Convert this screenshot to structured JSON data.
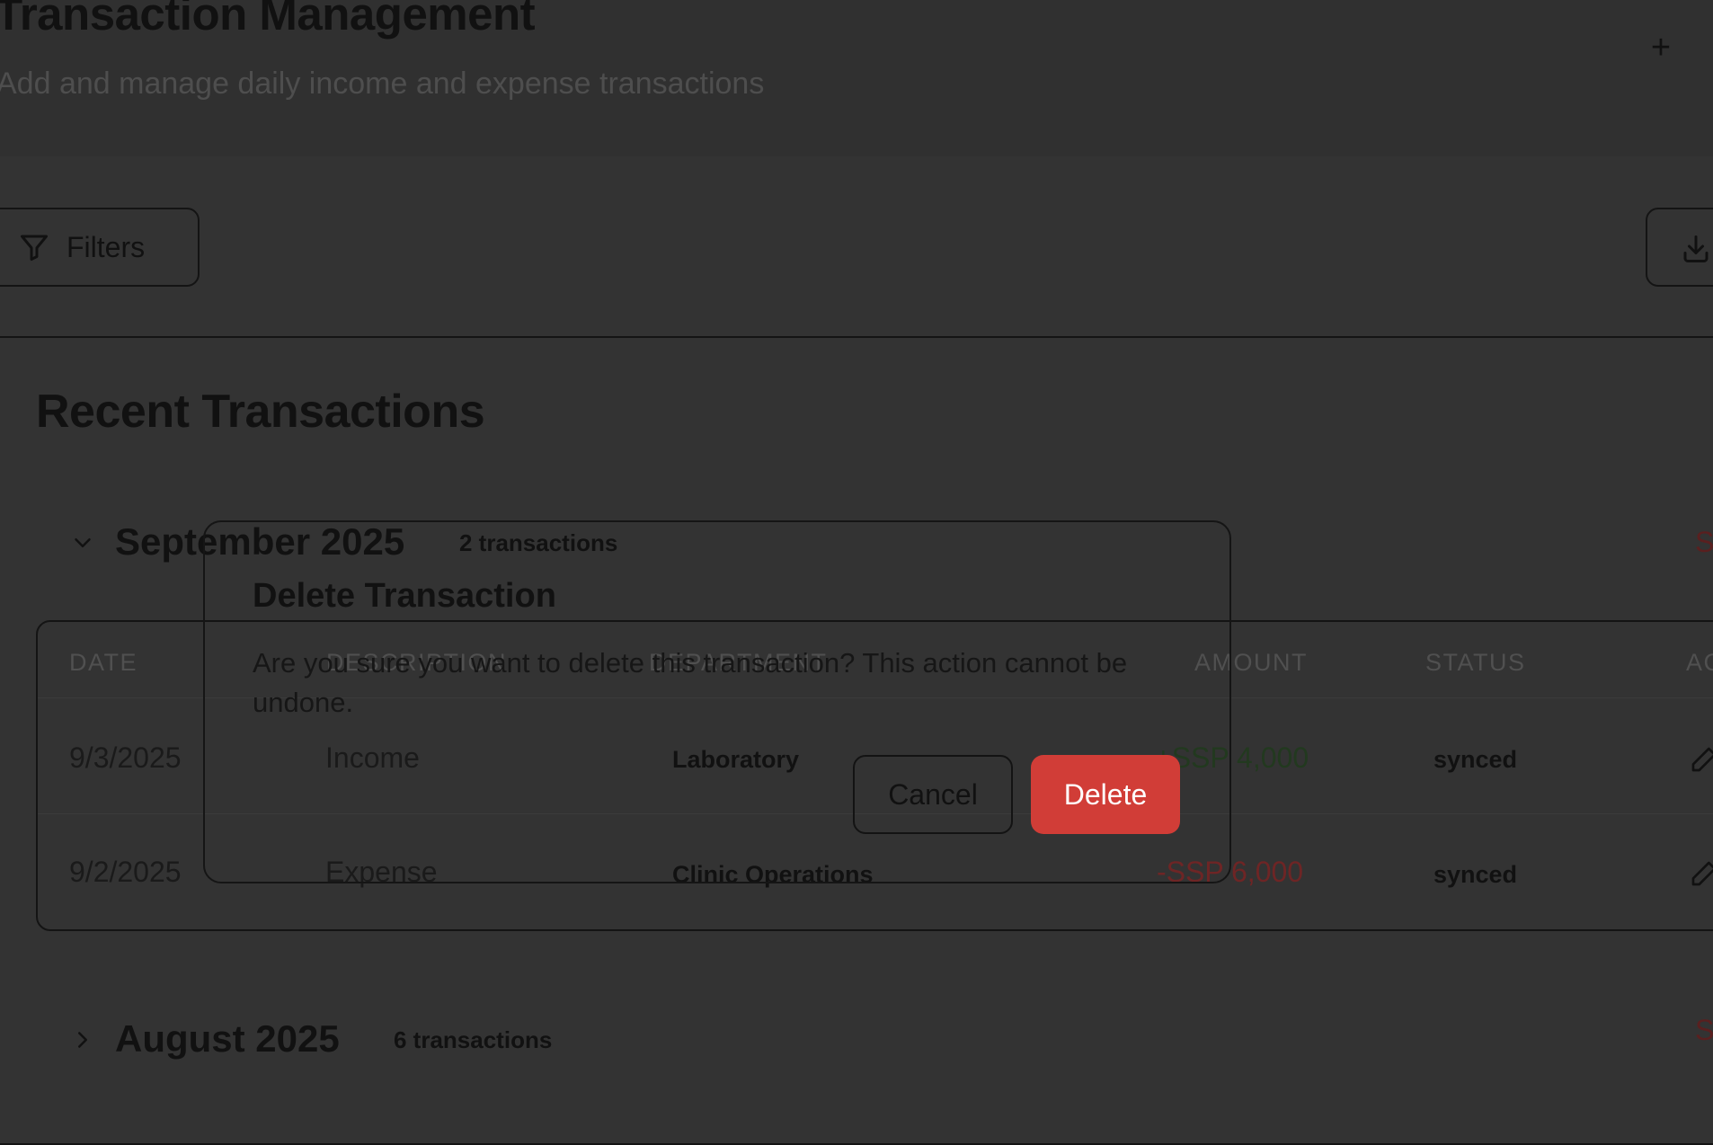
{
  "header": {
    "title": "Transaction Management",
    "subtitle": "Add and manage daily income and expense transactions",
    "add_icon": "plus-icon"
  },
  "toolbar": {
    "filters_label": "Filters",
    "filters_icon": "filter-icon",
    "export_icon": "download-icon"
  },
  "card": {
    "title": "Recent Transactions"
  },
  "table": {
    "columns": [
      "DATE",
      "DESCRIPTION",
      "DEPARTMENT",
      "AMOUNT",
      "STATUS",
      "AC"
    ]
  },
  "months": [
    {
      "name": "September 2025",
      "count": "2 transactions",
      "total": "S",
      "expanded": true,
      "rows": [
        {
          "date": "9/3/2025",
          "description": "Income",
          "department": "Laboratory",
          "amount": "+SSP 4,000",
          "status": "synced"
        },
        {
          "date": "9/2/2025",
          "description": "Expense",
          "department": "Clinic Operations",
          "amount": "-SSP 6,000",
          "status": "synced"
        }
      ]
    },
    {
      "name": "August 2025",
      "count": "6 transactions",
      "total": "S",
      "expanded": false
    }
  ],
  "dialog": {
    "title": "Delete Transaction",
    "message": "Are you sure you want to delete this transaction? This action cannot be undone.",
    "cancel_label": "Cancel",
    "delete_label": "Delete"
  },
  "colors": {
    "overlay": "#333333",
    "delete_button": "#d13d37",
    "income_amount": "#22391f",
    "expense_amount": "#6e2525"
  }
}
